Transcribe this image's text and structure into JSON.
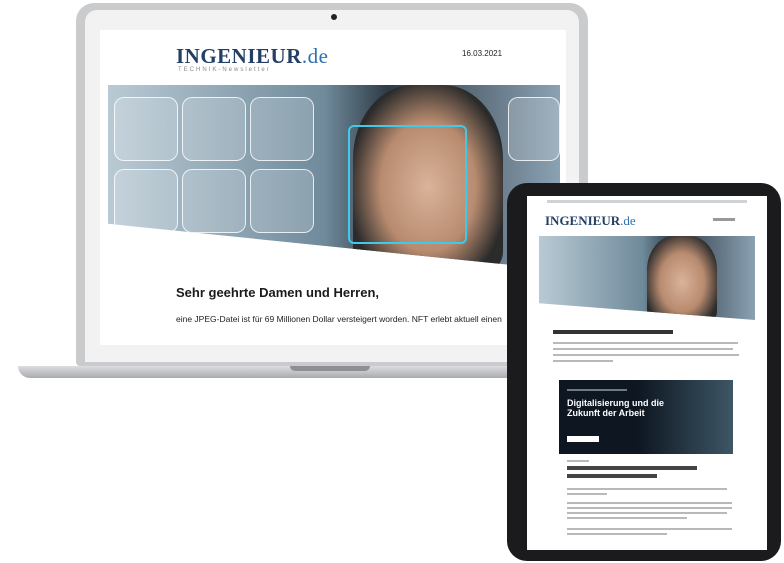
{
  "laptop": {
    "logo_main": "INGENIEUR",
    "logo_domain": ".de",
    "logo_sub": "TECHNIK-Newsletter",
    "date": "16.03.2021",
    "greeting": "Sehr geehrte Damen und Herren,",
    "body_line": "eine JPEG-Datei ist für 69 Millionen Dollar versteigert worden. NFT erlebt aktuell einen"
  },
  "tablet": {
    "logo_main": "INGENIEUR",
    "logo_domain": ".de",
    "banner_title": "Digitalisierung und die Zukunft der Arbeit"
  },
  "colors": {
    "brand_navy": "#233f66",
    "brand_blue": "#2d6fb0",
    "scan_cyan": "#42c8e8"
  }
}
